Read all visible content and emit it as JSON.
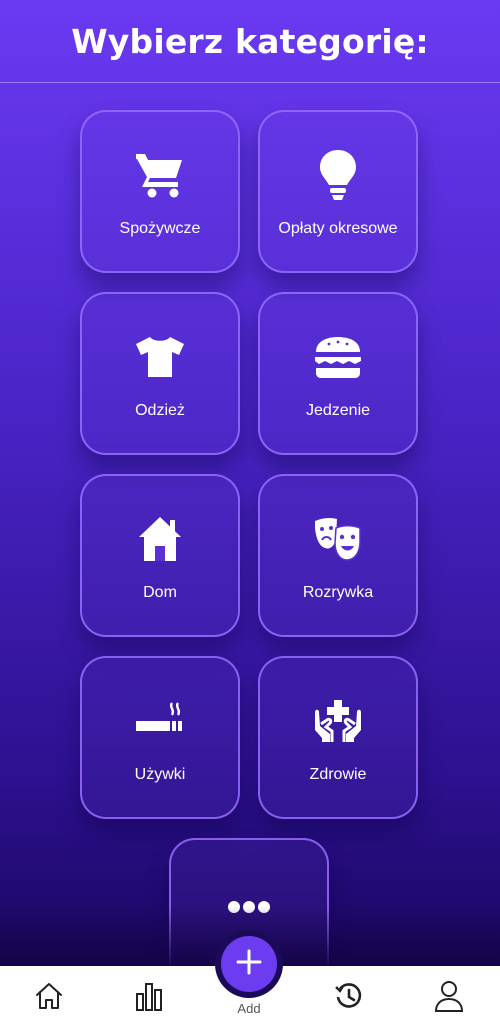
{
  "header": {
    "title": "Wybierz kategorię:"
  },
  "categories": [
    {
      "label": "Spożywcze",
      "icon": "cart-icon"
    },
    {
      "label": "Opłaty okresowe",
      "icon": "lightbulb-icon"
    },
    {
      "label": "Odzież",
      "icon": "tshirt-icon"
    },
    {
      "label": "Jedzenie",
      "icon": "burger-icon"
    },
    {
      "label": "Dom",
      "icon": "house-icon"
    },
    {
      "label": "Rozrywka",
      "icon": "theater-masks-icon"
    },
    {
      "label": "Używki",
      "icon": "cigarette-icon"
    },
    {
      "label": "Zdrowie",
      "icon": "health-hands-icon"
    },
    {
      "label": "",
      "icon": "more-icon"
    }
  ],
  "navbar": {
    "items": [
      "home-icon",
      "stats-icon",
      "add-icon",
      "history-icon",
      "profile-icon"
    ],
    "add_label": "Add"
  },
  "colors": {
    "accent": "#6c3cf0",
    "gradient_top": "#6a3af2",
    "gradient_bottom": "#1a0660",
    "tile_border": "#9a72ff"
  }
}
